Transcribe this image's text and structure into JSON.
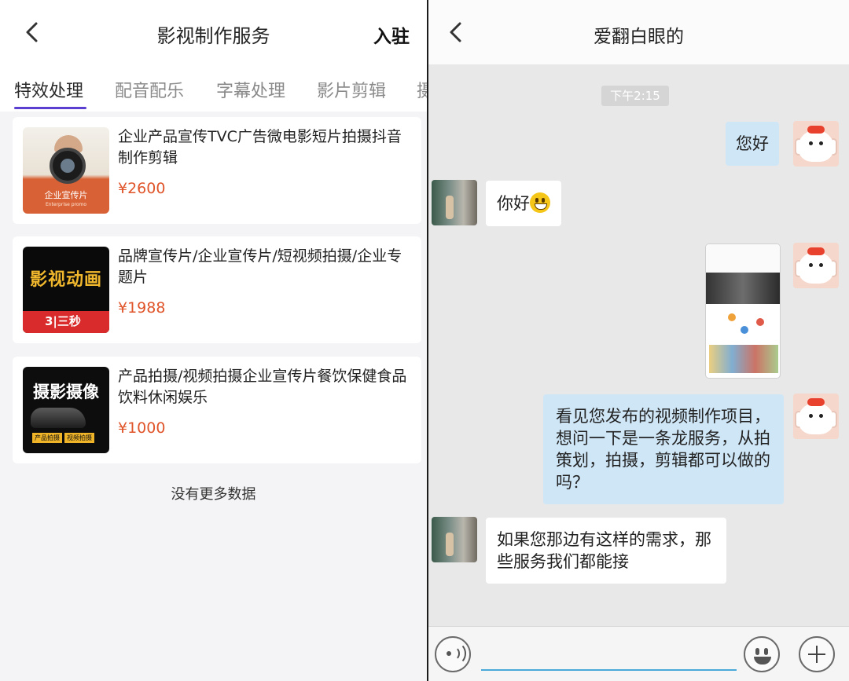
{
  "left": {
    "header": {
      "title": "影视制作服务",
      "right_action": "入驻"
    },
    "tabs": [
      {
        "label": "特效处理",
        "active": true
      },
      {
        "label": "配音配乐",
        "active": false
      },
      {
        "label": "字幕处理",
        "active": false
      },
      {
        "label": "影片剪辑",
        "active": false
      },
      {
        "label": "摄",
        "active": false
      }
    ],
    "products": [
      {
        "title": "企业产品宣传TVC广告微电影短片拍摄抖音制作剪辑",
        "price": "¥2600",
        "thumb_text": "企业宣传片",
        "thumb_sub": "Enterprise promo"
      },
      {
        "title": "品牌宣传片/企业宣传片/短视频拍摄/企业专题片",
        "price": "¥1988",
        "thumb_text": "影视动画",
        "thumb_logo": "3|三秒"
      },
      {
        "title": "产品拍摄/视频拍摄企业宣传片餐饮保健食品饮料休闲娱乐",
        "price": "¥1000",
        "thumb_text": "摄影摄像",
        "thumb_tags": [
          "产品拍摄",
          "视频拍摄"
        ]
      }
    ],
    "no_more": "没有更多数据"
  },
  "right": {
    "header": {
      "title": "爱翻白眼的"
    },
    "timestamp": "下午2:15",
    "messages": [
      {
        "from": "me",
        "text": "您好"
      },
      {
        "from": "other",
        "text": "你好"
      },
      {
        "from": "me",
        "type": "image"
      },
      {
        "from": "me",
        "text": "看见您发布的视频制作项目，想问一下是一条龙服务，从拍策划，拍摄，剪辑都可以做的吗？"
      },
      {
        "from": "other",
        "text": "如果您那边有这样的需求，那些服务我们都能接"
      }
    ]
  },
  "colors": {
    "accent_tab": "#5a3fd0",
    "price": "#e0542a",
    "my_bubble": "#cfe6f7",
    "input_underline": "#49a9d9"
  },
  "icons": [
    "back-arrow-icon",
    "voice-icon",
    "emoji-icon",
    "plus-icon",
    "grin-emoji-icon"
  ]
}
